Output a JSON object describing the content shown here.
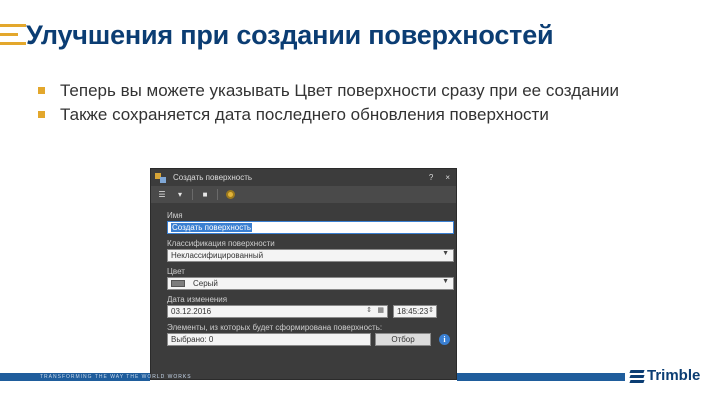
{
  "slide": {
    "title": "Улучшения при создании поверхностей",
    "bullets": [
      "Теперь вы можете указывать Цвет поверхности сразу при ее создании",
      "Также сохраняется дата последнего обновления поверхности"
    ]
  },
  "dialog": {
    "title": "Создать поверхность",
    "help": "?",
    "close": "×",
    "name_label": "Имя",
    "name_value": "Создать поверхность",
    "classification_label": "Классификация поверхности",
    "classification_value": "Неклассифицированный",
    "color_label": "Цвет",
    "color_value": "Серый",
    "color_swatch": "#7d7d7d",
    "date_label": "Дата изменения",
    "date_value": "03.12.2016",
    "time_value": "18:45:23",
    "elements_label": "Элементы, из которых будет сформирована поверхность:",
    "selected_value": "Выбрано: 0",
    "select_button": "Отбор",
    "info_glyph": "i"
  },
  "footer": {
    "tagline": "TRANSFORMING THE WAY THE WORLD WORKS",
    "logo": "Trimble",
    "accent_color": "#1f5d9c",
    "bullet_color": "#e3a72c"
  }
}
